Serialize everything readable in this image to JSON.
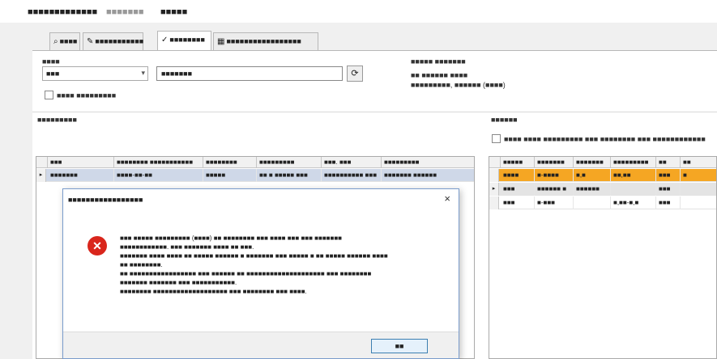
{
  "menu": [
    "■■■■■",
    "■■■■■■■■",
    "■■■■■■■",
    "■■■■■"
  ],
  "tabs": [
    {
      "icon": "⌕",
      "label": "■■■■"
    },
    {
      "icon": "✎",
      "label": "■■■■■■■■■■■"
    },
    {
      "icon": "✓",
      "label": "■■■■■■■■"
    },
    {
      "icon": "▦",
      "label": "■■■■■■■■■■■■■■■■■"
    }
  ],
  "search": {
    "label": "■■■■",
    "combo_value": "■■■",
    "text_value": "■■■■■■■",
    "refresh_icon": "⟳",
    "checkbox_label": "■■■■ ■■■■■■■■■"
  },
  "patient": {
    "label": "■■■■■ ■■■■■■■",
    "id_line": "■■ ■■■■■■ ■■■■",
    "name_line": "■■■■■■■■■, ■■■■■■ (■■■■)"
  },
  "order": {
    "section_label": "■■■■■■■■■",
    "columns": [
      "■■■",
      "■■■■■■■■ ■■■■■■■■■■■",
      "■■■■■■■■",
      "■■■■■■■■■",
      "■■■. ■■■",
      "■■■■■■■■■"
    ],
    "rows": [
      [
        "■■■■■■■",
        "■■■■-■■-■■",
        "■■■■■",
        "■■ ■ ■■■■■ ■■■",
        "■■■■■■■■■■ ■■■",
        "■■■■■■■ ■■■■■■"
      ]
    ]
  },
  "analysis": {
    "section_label": "■■■■■■",
    "checkbox_label": "■■■■ ■■■■ ■■■■■■■■■ ■■■ ■■■■■■■■ ■■■ ■■■■■■■■■■■■",
    "columns": [
      "■■■■■",
      "■■■■■■■",
      "■■■■■■■",
      "■■■■■■■■■",
      "■■",
      "■■"
    ],
    "rows": [
      {
        "cells": [
          "■■■■",
          "■-■■■■",
          "■,■",
          "■■,■■",
          "■■■",
          "■"
        ],
        "highlight": true
      },
      {
        "cells": [
          "■■■",
          "■■■■■■ ■",
          "■■■■■■",
          "",
          "■■■",
          ""
        ],
        "highlight": false
      },
      {
        "cells": [
          "■■■",
          "■-■■■",
          "",
          "■,■■-■,■",
          "■■■",
          ""
        ],
        "highlight": false
      }
    ]
  },
  "dialog": {
    "title": "■■■■■■■■■■■■■■■■■",
    "close": "×",
    "icon": "✕",
    "lines": [
      "■■■ ■■■■■ ■■■■■■■■■ (■■■■) ■■ ■■■■■■■■ ■■■ ■■■■ ■■■ ■■■ ■■■■■■■",
      "■■■■■■■■■■■■. ■■■ ■■■■■■■ ■■■■ ■■ ■■■.",
      "■■■■■■■ ■■■■ ■■■■ ■■ ■■■■■ ■■■■■■ ■ ■■■■■■■ ■■■ ■■■■■ ■ ■■ ■■■■■ ■■■■■■ ■■■■",
      "■■ ■■■■■■■■.",
      "■■ ■■■■■■■■■■■■■■■■■ ■■■ ■■■■■■ ■■ ■■■■■■■■■■■■■■■■■■■■ ■■■ ■■■■■■■■",
      "■■■■■■■ ■■■■■■■ ■■■ ■■■■■■■■■■■.",
      "■■■■■■■■ ■■■■■■■■■■■■■■■■■■■ ■■■ ■■■■■■■■ ■■■ ■■■■."
    ],
    "ok": "■■"
  },
  "colors": {
    "highlight": "#f5a623",
    "selected": "#cfd8e8",
    "error": "#d9261c"
  }
}
